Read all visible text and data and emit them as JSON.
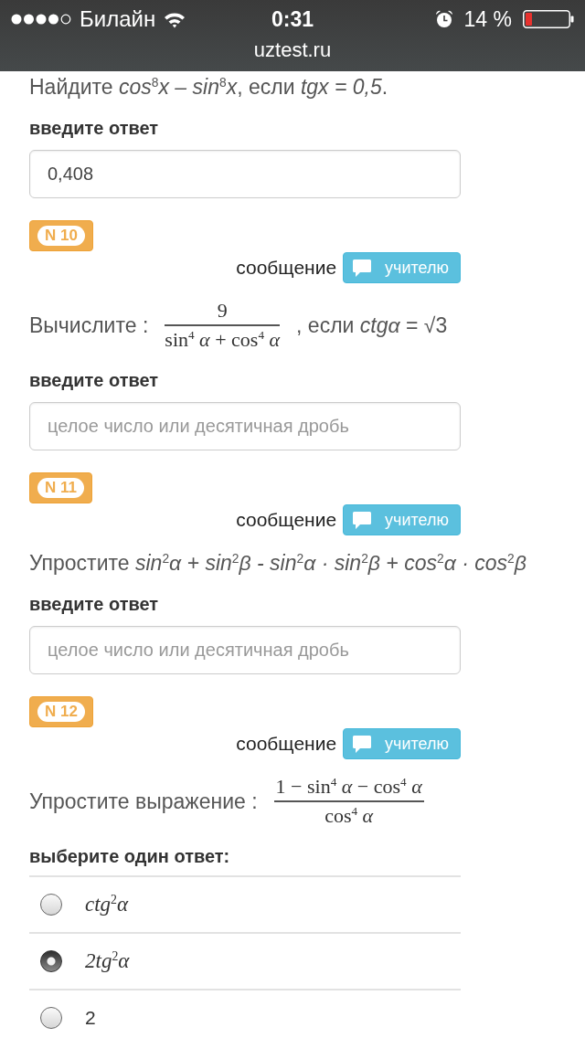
{
  "status_bar": {
    "carrier": "Билайн",
    "time": "0:31",
    "battery": "14 %"
  },
  "address_bar": {
    "url": "uztest.ru"
  },
  "questions": [
    {
      "parts": [
        {
          "kind": "text",
          "text": "Найдите *cos*$^{8}$*x – sin*$^{8}$*x*, если *tgx = 0,5*."
        }
      ],
      "answer_label": "введите ответ",
      "answer": {
        "kind": "input",
        "value": "0,408"
      }
    },
    {
      "badge": "N 10",
      "message_label": "сообщение",
      "message_button": "учителю",
      "parts": [
        {
          "kind": "text",
          "text": "Вычислите :"
        },
        {
          "kind": "fraction",
          "numerator": "9",
          "denominator": "sin$^{4}$ *α* + cos$^{4}$ *α*"
        },
        {
          "kind": "text",
          "text": ", если *ctgα* = √3"
        }
      ],
      "answer_label": "введите ответ",
      "answer": {
        "kind": "input",
        "placeholder": "целое число или десятичная дробь"
      }
    },
    {
      "badge": "N 11",
      "message_label": "сообщение",
      "message_button": "учителю",
      "parts": [
        {
          "kind": "text",
          "text": "Упростите *sin*$^{2}$*α + sin*$^{2}$*β - sin*$^{2}$*α · sin*$^{2}$*β + cos*$^{2}$*α · cos*$^{2}$*β*"
        }
      ],
      "answer_label": "введите ответ",
      "answer": {
        "kind": "input",
        "placeholder": "целое число или десятичная дробь"
      }
    },
    {
      "badge": "N 12",
      "message_label": "сообщение",
      "message_button": "учителю",
      "parts": [
        {
          "kind": "text",
          "text": "Упростите выражение :"
        },
        {
          "kind": "fraction",
          "numerator": "1 − sin$^{4}$ *α* − cos$^{4}$ *α*",
          "denominator": "cos$^{4}$ *α*"
        }
      ],
      "answer_label": "выберите один ответ:",
      "answer": {
        "kind": "choice",
        "options": [
          {
            "kind": "math",
            "text": "ctg$^{2}$α",
            "selected": false
          },
          {
            "kind": "math",
            "text": "2tg$^{2}$α",
            "selected": true
          },
          {
            "kind": "text",
            "text": "2",
            "selected": false
          }
        ]
      }
    }
  ]
}
